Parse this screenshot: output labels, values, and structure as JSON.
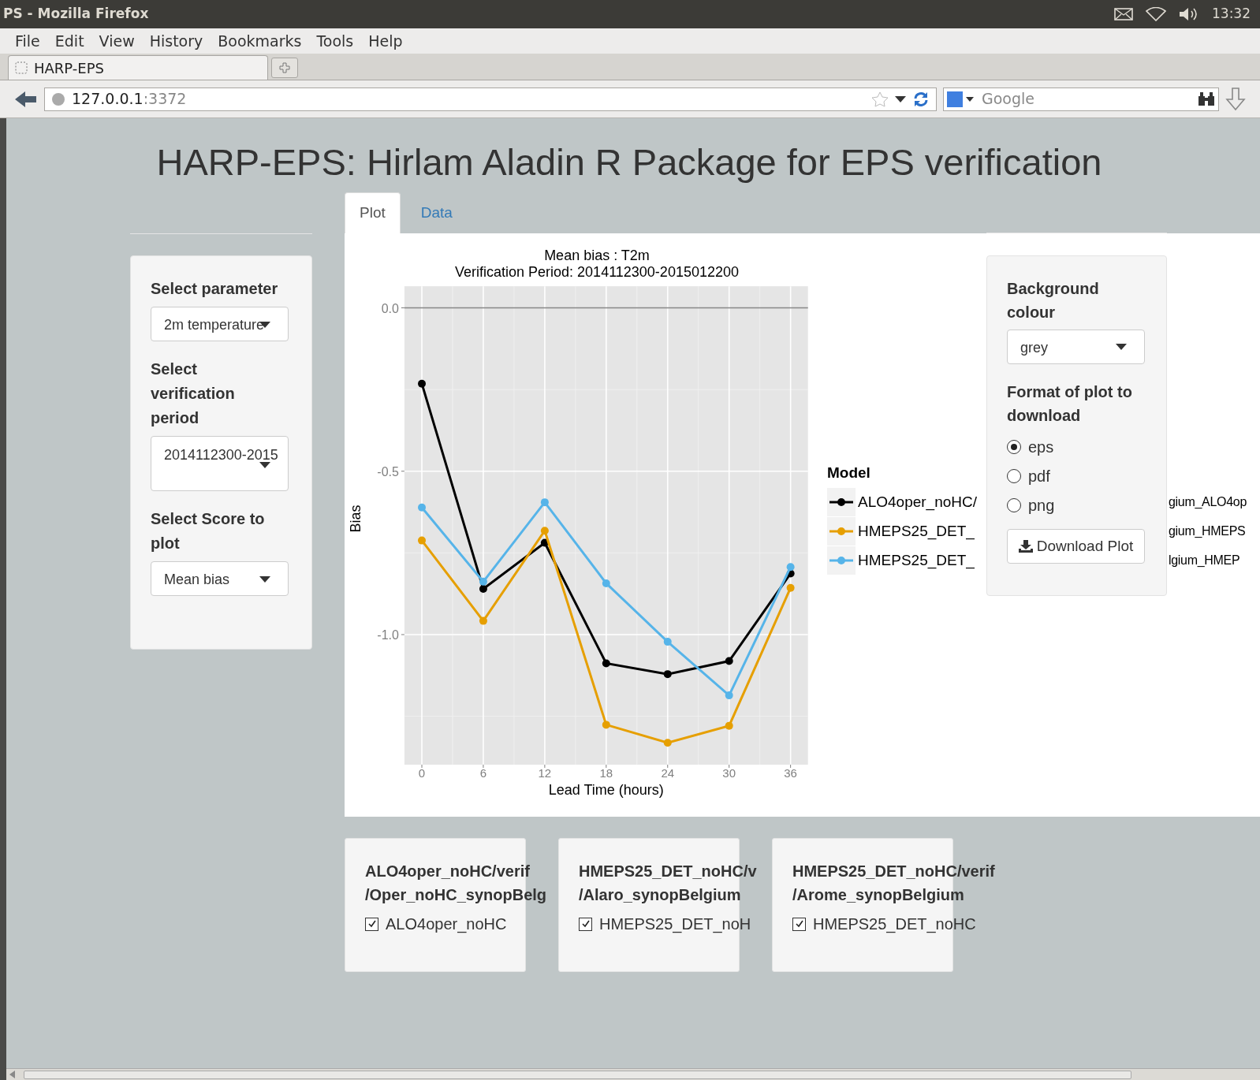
{
  "window": {
    "title": "PS - Mozilla Firefox",
    "clock": "13:32"
  },
  "menu": [
    "File",
    "Edit",
    "View",
    "History",
    "Bookmarks",
    "Tools",
    "Help"
  ],
  "browser_tabs": [
    {
      "label": "HARP-EPS",
      "selected": true
    }
  ],
  "address": {
    "host": "127.0.0.1",
    "port": ":3372"
  },
  "search": {
    "placeholder": "Google"
  },
  "page": {
    "title": "HARP-EPS: Hirlam Aladin R Package for EPS verification"
  },
  "tabs": [
    {
      "label": "Plot",
      "selected": true
    },
    {
      "label": "Data",
      "selected": false
    }
  ],
  "sidebar": {
    "fields": [
      {
        "kind": "single",
        "label": "Select parameter",
        "value": "2m temperature"
      },
      {
        "kind": "tall",
        "label": "Select verification period",
        "value": "2014112300-2015"
      },
      {
        "kind": "single",
        "label": "Select Score to plot",
        "value": "Mean bias"
      }
    ]
  },
  "chart_data": {
    "type": "line",
    "grid": true,
    "title": "Mean bias : T2m\nVerification Period: 2014112300-2015012200",
    "xlabel": "Lead Time (hours)",
    "ylabel": "Bias",
    "x": [
      0,
      6,
      12,
      18,
      24,
      30,
      36
    ],
    "series": [
      {
        "name": "ALO4oper_noHC/",
        "color": "#000000",
        "marker": true,
        "values": [
          -0.232,
          -0.86,
          -0.719,
          -1.088,
          -1.121,
          -1.081,
          -0.813
        ]
      },
      {
        "name": "HMEPS25_DET_",
        "color": "#e69f00",
        "marker": true,
        "values": [
          -0.712,
          -0.958,
          -0.682,
          -1.276,
          -1.331,
          -1.279,
          -0.857
        ]
      },
      {
        "name": "HMEPS25_DET_",
        "color": "#56b4e9",
        "marker": true,
        "values": [
          -0.611,
          -0.838,
          -0.595,
          -0.843,
          -1.022,
          -1.186,
          -0.793
        ]
      }
    ],
    "xlim": [
      -1.7,
      37.7
    ],
    "ylim": [
      -1.398,
      0.066
    ],
    "xticks": [
      0,
      6,
      12,
      18,
      24,
      30,
      36
    ],
    "yticks": [
      {
        "value": 0,
        "label": "0.0"
      },
      {
        "value": -0.5,
        "label": "-0.5"
      },
      {
        "value": -1,
        "label": "-1.0"
      }
    ]
  },
  "legend": {
    "title": "Model",
    "tails": [
      "gium_ALO4op",
      "gium_HMEPS",
      "lgium_HMEP"
    ]
  },
  "options": {
    "background_label": "Background colour",
    "background_value": "grey",
    "format_label": "Format of plot to download",
    "formats": [
      {
        "label": "eps",
        "selected": true
      },
      {
        "label": "pdf",
        "selected": false
      },
      {
        "label": "png",
        "selected": false
      }
    ],
    "download": "Download Plot"
  },
  "model_cards": [
    {
      "title_lines": [
        "ALO4oper_noHC/verif",
        "/Oper_noHC_synopBelg"
      ],
      "checkbox": {
        "label": "ALO4oper_noHC",
        "checked": true
      }
    },
    {
      "title_lines": [
        "HMEPS25_DET_noHC/v",
        "/Alaro_synopBelgium"
      ],
      "checkbox": {
        "label": "HMEPS25_DET_noH",
        "checked": true
      }
    },
    {
      "title_lines": [
        "HMEPS25_DET_noHC/verif",
        "/Arome_synopBelgium"
      ],
      "checkbox": {
        "label": "HMEPS25_DET_noHC",
        "checked": true
      }
    }
  ]
}
